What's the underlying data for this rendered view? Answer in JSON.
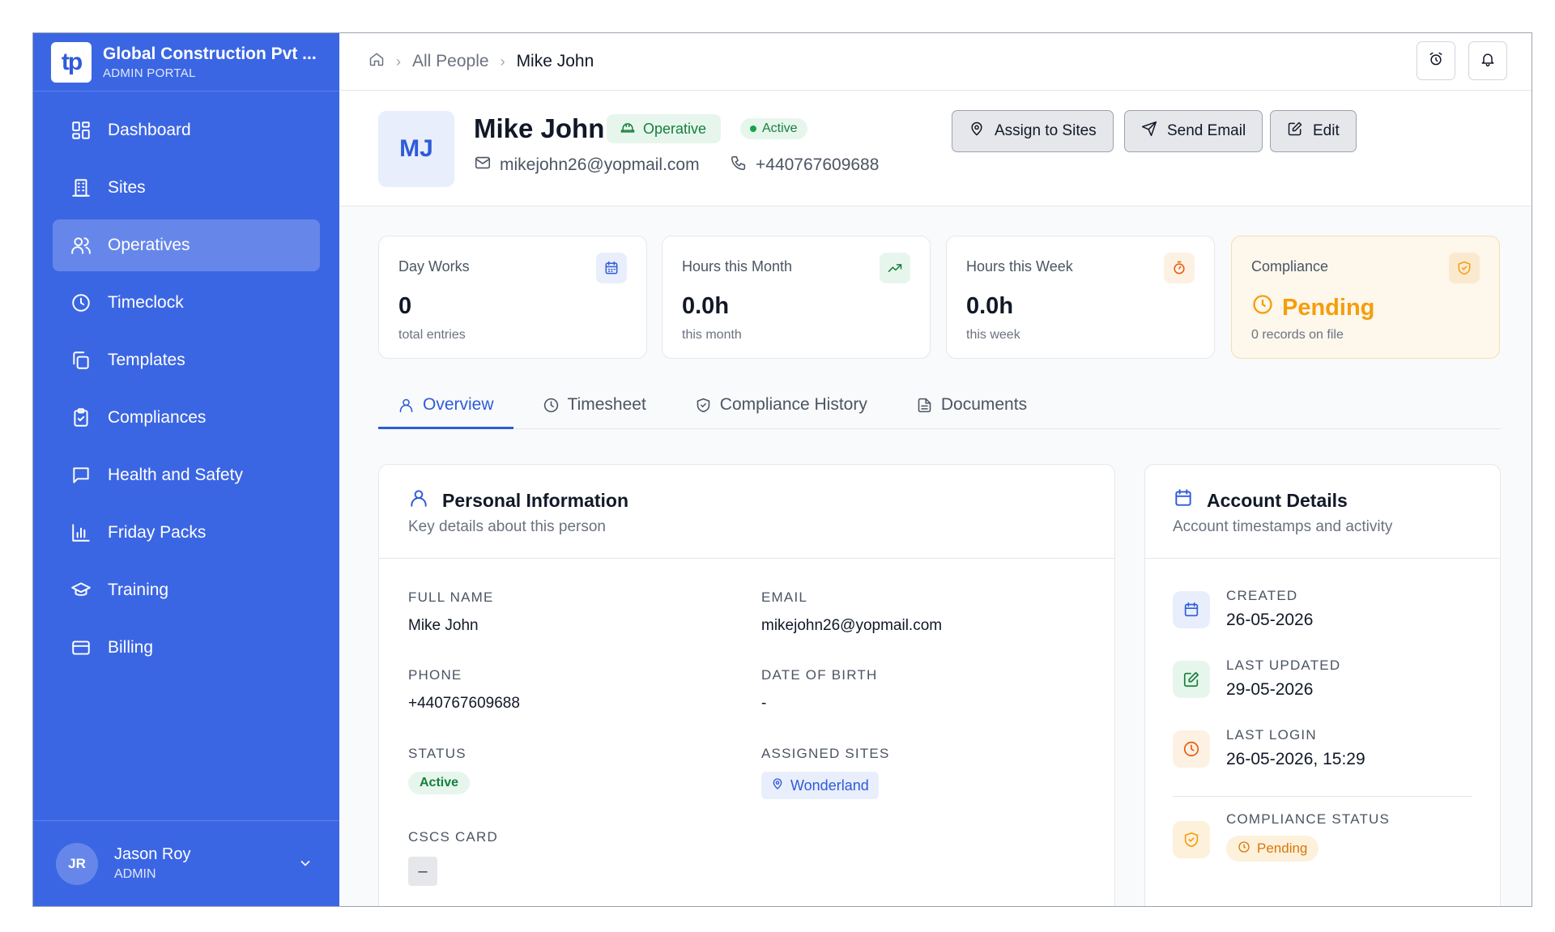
{
  "brand": {
    "logo": "tp",
    "name": "Global Construction Pvt ...",
    "subtitle": "ADMIN PORTAL"
  },
  "sidebar": {
    "items": [
      {
        "label": "Dashboard",
        "icon": "dashboard-icon"
      },
      {
        "label": "Sites",
        "icon": "building-icon"
      },
      {
        "label": "Operatives",
        "icon": "users-icon",
        "active": true
      },
      {
        "label": "Timeclock",
        "icon": "clock-icon"
      },
      {
        "label": "Templates",
        "icon": "copy-icon"
      },
      {
        "label": "Compliances",
        "icon": "clipboard-check-icon"
      },
      {
        "label": "Health and Safety",
        "icon": "message-square-icon"
      },
      {
        "label": "Friday Packs",
        "icon": "bar-chart-icon"
      },
      {
        "label": "Training",
        "icon": "graduation-cap-icon"
      },
      {
        "label": "Billing",
        "icon": "credit-card-icon"
      }
    ]
  },
  "user": {
    "initials": "JR",
    "name": "Jason Roy",
    "role": "ADMIN"
  },
  "breadcrumb": {
    "parent": "All People",
    "current": "Mike John"
  },
  "profile": {
    "initials": "MJ",
    "name": "Mike John",
    "role_badge": "Operative",
    "status_badge": "Active",
    "email": "mikejohn26@yopmail.com",
    "phone": "+440767609688"
  },
  "actions": {
    "assign": "Assign to Sites",
    "email": "Send Email",
    "edit": "Edit"
  },
  "stats": [
    {
      "label": "Day Works",
      "value": "0",
      "sub": "total entries",
      "icon": "calendar-icon"
    },
    {
      "label": "Hours this Month",
      "value": "0.0h",
      "sub": "this month",
      "icon": "trending-up-icon"
    },
    {
      "label": "Hours this Week",
      "value": "0.0h",
      "sub": "this week",
      "icon": "timer-icon"
    },
    {
      "label": "Compliance",
      "value": "Pending",
      "sub": "0 records on file",
      "icon": "shield-icon"
    }
  ],
  "tabs": [
    {
      "label": "Overview",
      "active": true
    },
    {
      "label": "Timesheet"
    },
    {
      "label": "Compliance History"
    },
    {
      "label": "Documents"
    }
  ],
  "personal": {
    "title": "Personal Information",
    "subtitle": "Key details about this person",
    "fields": {
      "full_name_label": "FULL NAME",
      "full_name": "Mike John",
      "email_label": "EMAIL",
      "email": "mikejohn26@yopmail.com",
      "phone_label": "PHONE",
      "phone": "+440767609688",
      "dob_label": "DATE OF BIRTH",
      "dob": "-",
      "status_label": "STATUS",
      "status": "Active",
      "sites_label": "ASSIGNED SITES",
      "site": "Wonderland",
      "cscs_label": "CSCS CARD",
      "cscs": "–"
    }
  },
  "account": {
    "title": "Account Details",
    "subtitle": "Account timestamps and activity",
    "created_label": "CREATED",
    "created": "26-05-2026",
    "updated_label": "LAST UPDATED",
    "updated": "29-05-2026",
    "login_label": "LAST LOGIN",
    "login": "26-05-2026, 15:29",
    "compliance_label": "COMPLIANCE STATUS",
    "compliance": "Pending"
  },
  "colors": {
    "primary": "#3b66e3",
    "accent": "#2f5bd8",
    "success": "#15803d",
    "warning": "#f59e0b"
  }
}
